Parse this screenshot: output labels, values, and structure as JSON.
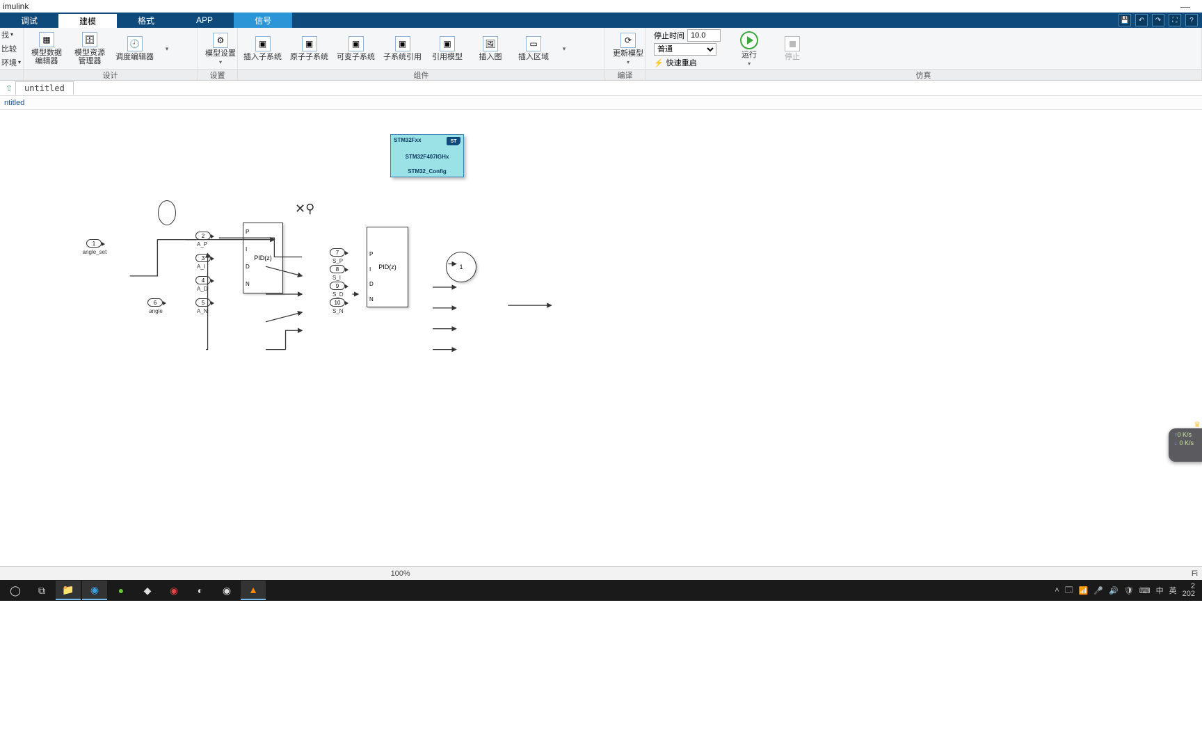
{
  "titlebar": {
    "app_name": "imulink"
  },
  "tabs": {
    "debug": "调试",
    "modeling": "建模",
    "format": "格式",
    "app": "APP",
    "signal": "信号"
  },
  "ribbon": {
    "edge": {
      "find": "找",
      "compare": "比较",
      "env": "环境"
    },
    "model_data_editor": "模型数据\n编辑器",
    "model_resource_manager": "模型资源\n管理器",
    "schedule_editor": "调度编辑器",
    "model_settings": "模型设置",
    "insert_subsystem": "插入子系统",
    "atomic_subsystem": "原子子系统",
    "variant_subsystem": "可变子系统",
    "subsystem_ref": "子系统引用",
    "ref_model": "引用模型",
    "insert_image": "插入图",
    "insert_area": "插入区域",
    "update_model": "更新模型",
    "stop_time_label": "停止时间",
    "stop_time_value": "10.0",
    "mode_value": "普通",
    "fast_restart": "快速重启",
    "run": "运行",
    "stop": "停止"
  },
  "group_labels": {
    "design": "设计",
    "settings": "设置",
    "components": "组件",
    "compile": "编译",
    "simulate": "仿真"
  },
  "breadcrumb": {
    "tab": "untitled"
  },
  "path": {
    "text": "ntitled"
  },
  "stm32": {
    "line1": "STM32Fxx",
    "line2": "STM32F407IGHx",
    "line3": "STM32_Config",
    "logo": "ST"
  },
  "ports": {
    "p1": "1",
    "p1_label": "angle_set",
    "p6": "6",
    "p6_label": "angle",
    "p2": "2",
    "p2_label": "A_P",
    "p3": "3",
    "p3_label": "A_I",
    "p4": "4",
    "p4_label": "A_D",
    "p5": "5",
    "p5_label": "A_N",
    "p7": "7",
    "p7_label": "S_P",
    "p8": "8",
    "p8_label": "S_I",
    "p9": "9",
    "p9_label": "S_D",
    "p10": "10",
    "p10_label": "S_N",
    "out1": "1"
  },
  "pid": {
    "label": "PID(z)",
    "pins": {
      "P": "P",
      "I": "I",
      "D": "D",
      "N": "N"
    }
  },
  "statusbar": {
    "zoom": "100%",
    "right": "Fi"
  },
  "netwidget": {
    "up": "0 K/s",
    "down": "0 K/s"
  },
  "taskbar": {
    "lang": "英",
    "ime": "中",
    "time": "2",
    "date": "202"
  }
}
